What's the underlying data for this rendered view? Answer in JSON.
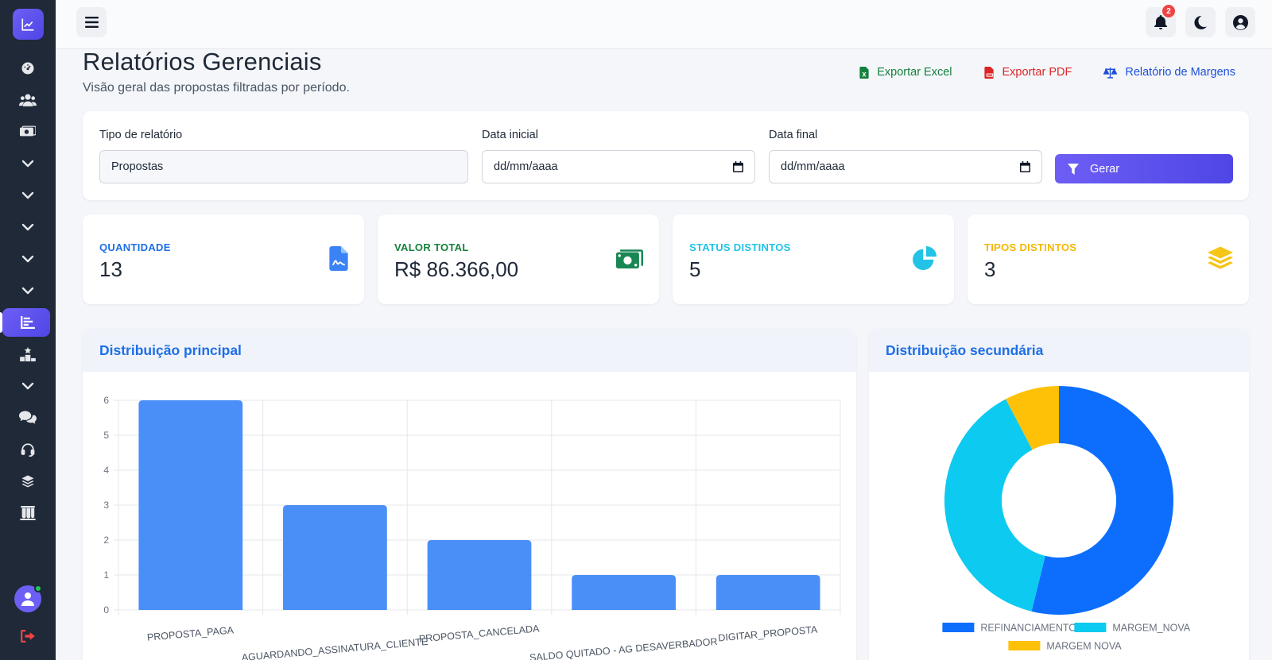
{
  "topbar": {
    "notification_count": "2"
  },
  "header": {
    "title": "Relatórios Gerenciais",
    "subtitle": "Visão geral das propostas filtradas por período.",
    "actions": {
      "excel": "Exportar Excel",
      "pdf": "Exportar PDF",
      "margins": "Relatório de Margens"
    }
  },
  "filters": {
    "report_type_label": "Tipo de relatório",
    "report_type_value": "Propostas",
    "start_label": "Data inicial",
    "start_value": "dd/mm/aaaa",
    "end_label": "Data final",
    "end_value": "dd/mm/aaaa",
    "generate_label": "Gerar"
  },
  "stats": [
    {
      "label": "QUANTIDADE",
      "value": "13",
      "color": "#1d6fe6",
      "icon": "file-invoice-icon"
    },
    {
      "label": "VALOR TOTAL",
      "value": "R$ 86.366,00",
      "color": "#15803d",
      "icon": "money-bill-icon"
    },
    {
      "label": "STATUS DISTINTOS",
      "value": "5",
      "color": "#22c3e6",
      "icon": "chart-pie-icon"
    },
    {
      "label": "TIPOS DISTINTOS",
      "value": "3",
      "color": "#f5b800",
      "icon": "layers-icon"
    }
  ],
  "charts": {
    "primary_title": "Distribuição principal",
    "secondary_title": "Distribuição secundária"
  },
  "chart_data": [
    {
      "type": "bar",
      "categories": [
        "PROPOSTA_PAGA",
        "AGUARDANDO_ASSINATURA_CLIENTE",
        "PROPOSTA_CANCELADA",
        "SALDO QUITADO - AG DESAVERBADOR",
        "DIGITAR_PROPOSTA"
      ],
      "values": [
        6,
        3,
        2,
        1,
        1
      ],
      "ylim": [
        0,
        6
      ],
      "yticks": [
        0,
        1,
        2,
        3,
        4,
        5,
        6
      ],
      "grid": true,
      "color": "#4a8ff7"
    },
    {
      "type": "pie",
      "donut": true,
      "labels": [
        "REFINANCIAMENTO",
        "MARGEM_NOVA",
        "MARGEM NOVA"
      ],
      "values": [
        7,
        5,
        1
      ],
      "colors": [
        "#0d6efd",
        "#0dcaf0",
        "#ffc107"
      ],
      "legend": "bottom"
    }
  ]
}
